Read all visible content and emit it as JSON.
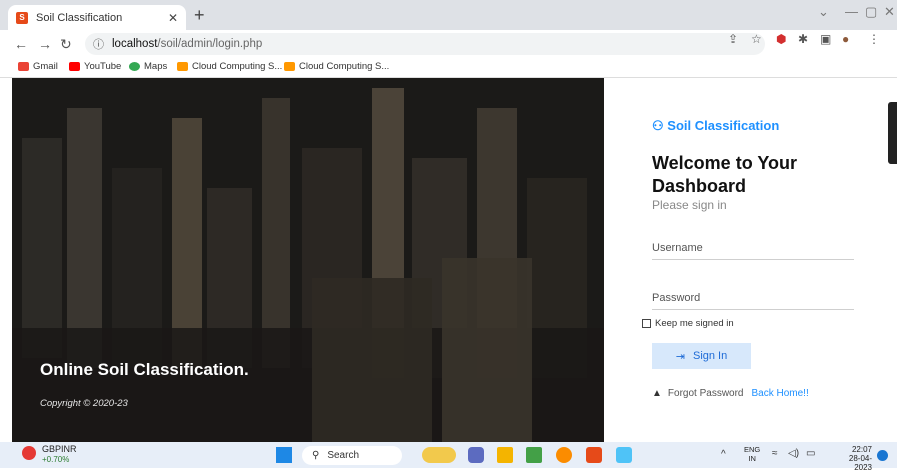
{
  "browser": {
    "tab_title": "Soil Classification",
    "url_host": "localhost",
    "url_path": "/soil/admin/login.php",
    "bookmarks": [
      "Gmail",
      "YouTube",
      "Maps",
      "Cloud Computing S...",
      "Cloud Computing S..."
    ]
  },
  "hero": {
    "title": "Online Soil Classification.",
    "copyright": "Copyright © 2020-23"
  },
  "login": {
    "brand": "Soil Classification",
    "heading": "Welcome to Your Dashboard",
    "subheading": "Please sign in",
    "username_placeholder": "Username",
    "password_placeholder": "Password",
    "keep_signed_in": "Keep me signed in",
    "sign_in": "Sign In",
    "forgot_password": "Forgot Password",
    "back_home": "Back Home!!"
  },
  "taskbar": {
    "stock_name": "GBPINR",
    "stock_change": "+0.70%",
    "search_label": "Search",
    "lang_top": "ENG",
    "lang_bottom": "IN",
    "time": "22:07",
    "date": "28-04-2023"
  },
  "colors": {
    "accent": "#1e90ff",
    "signin_bg": "#d7e8fb"
  }
}
